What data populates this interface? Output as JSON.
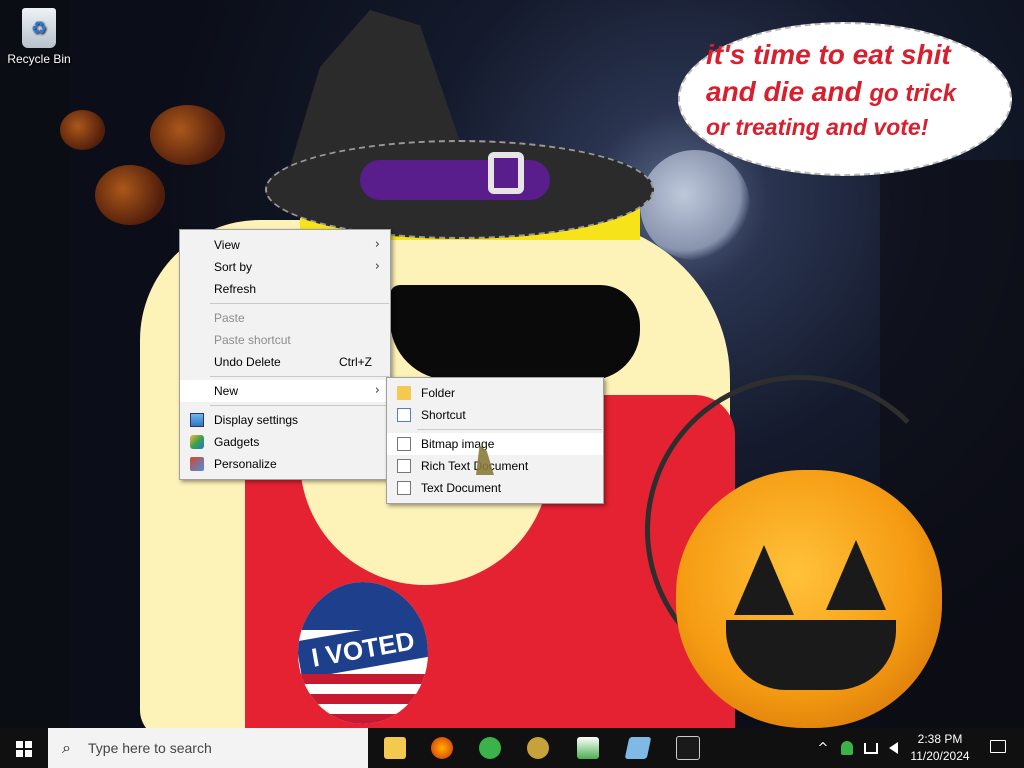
{
  "desktop": {
    "icons": [
      {
        "label": "Recycle Bin",
        "icon": "recycle-bin-icon"
      }
    ],
    "wallpaper": {
      "speech_bubble": {
        "line1": "it's time to eat shit",
        "line2_big": "and die and",
        "line2_small": "go trick",
        "line3": "or treating and vote!"
      },
      "badge_text": "I VOTED",
      "colors": {
        "bubble_text": "#d81f2e",
        "shirt": "#e52231",
        "skin": "#fdf2b8",
        "hat_band": "#5a1e8c"
      }
    }
  },
  "context_menu": {
    "items": [
      {
        "label": "View",
        "submenu": true
      },
      {
        "label": "Sort by",
        "submenu": true
      },
      {
        "label": "Refresh"
      },
      {
        "label": "Paste",
        "disabled": true
      },
      {
        "label": "Paste shortcut",
        "disabled": true
      },
      {
        "label": "Undo Delete",
        "shortcut": "Ctrl+Z"
      },
      {
        "label": "New",
        "submenu": true,
        "active": true
      },
      {
        "label": "Display settings",
        "icon": "display-settings-icon"
      },
      {
        "label": "Gadgets",
        "icon": "gadgets-icon"
      },
      {
        "label": "Personalize",
        "icon": "personalize-icon"
      }
    ]
  },
  "new_submenu": {
    "items": [
      {
        "label": "Folder",
        "icon": "folder-icon"
      },
      {
        "label": "Shortcut",
        "icon": "shortcut-icon"
      },
      {
        "label": "Bitmap image",
        "icon": "bitmap-image-icon",
        "hover": true
      },
      {
        "label": "Rich Text Document",
        "icon": "rich-text-document-icon"
      },
      {
        "label": "Text Document",
        "icon": "text-document-icon"
      }
    ]
  },
  "taskbar": {
    "search_placeholder": "Type here to search",
    "apps": [
      {
        "name": "file-explorer-icon",
        "color": "#f3c94f"
      },
      {
        "name": "firefox-icon",
        "color": "#e66000"
      },
      {
        "name": "people-chat-icon",
        "color": "#3bb34a"
      },
      {
        "name": "pirate-game-icon",
        "color": "#c7a23a"
      },
      {
        "name": "chart-tool-icon",
        "color": "#4caf50"
      },
      {
        "name": "notepad-icon",
        "color": "#7fb9e6"
      },
      {
        "name": "command-prompt-icon",
        "color": "#cccccc"
      }
    ],
    "tray": {
      "chevron": "^",
      "time": "2:38 PM",
      "date": "11/20/2024"
    }
  }
}
